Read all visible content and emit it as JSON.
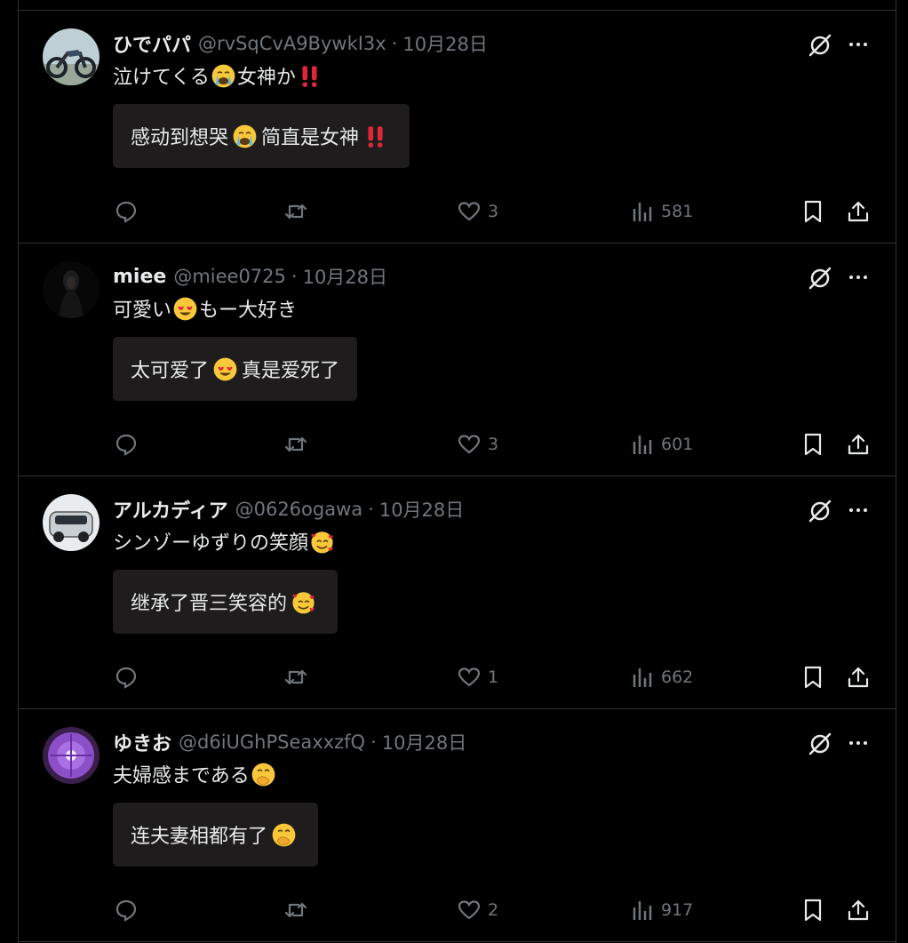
{
  "tweets": [
    {
      "name": "ひでパパ",
      "handle": "@rvSqCvA9BywkI3x",
      "time": "10月28日",
      "text_a": "泣けてくる",
      "text_b": "女神か",
      "text_emojis": [
        "loudly-crying-face",
        "double-exclamation"
      ],
      "translation_a": "感动到想哭",
      "translation_b": "简直是女神",
      "likes": "3",
      "views": "581",
      "avatar": "motorcycle"
    },
    {
      "name": "miee",
      "handle": "@miee0725",
      "time": "10月28日",
      "text_a": "可愛い",
      "text_b": "もー大好き",
      "text_emojis": [
        "heart-eyes-face"
      ],
      "translation_a": "太可爱了",
      "translation_b": "真是爱死了",
      "likes": "3",
      "views": "601",
      "avatar": "dark-figure"
    },
    {
      "name": "アルカディア",
      "handle": "@0626ogawa",
      "time": "10月28日",
      "text_a": "シンゾーゆずりの笑顔",
      "text_b": "",
      "text_emojis": [
        "smiling-face-with-hearts"
      ],
      "translation_a": "继承了晋三笑容的",
      "translation_b": "",
      "likes": "1",
      "views": "662",
      "avatar": "white-car"
    },
    {
      "name": "ゆきお",
      "handle": "@d6iUGhPSeaxxzfQ",
      "time": "10月28日",
      "text_a": "夫婦感まである",
      "text_b": "",
      "text_emojis": [
        "hand-over-mouth-face"
      ],
      "translation_a": "连夫妻相都有了",
      "translation_b": "",
      "likes": "2",
      "views": "917",
      "avatar": "purple-flower"
    }
  ],
  "colors": {
    "background": "#000000",
    "text": "#e7e9ea",
    "muted": "#71767b",
    "border": "#2f3336",
    "translation_box": "#1e1c1d"
  }
}
